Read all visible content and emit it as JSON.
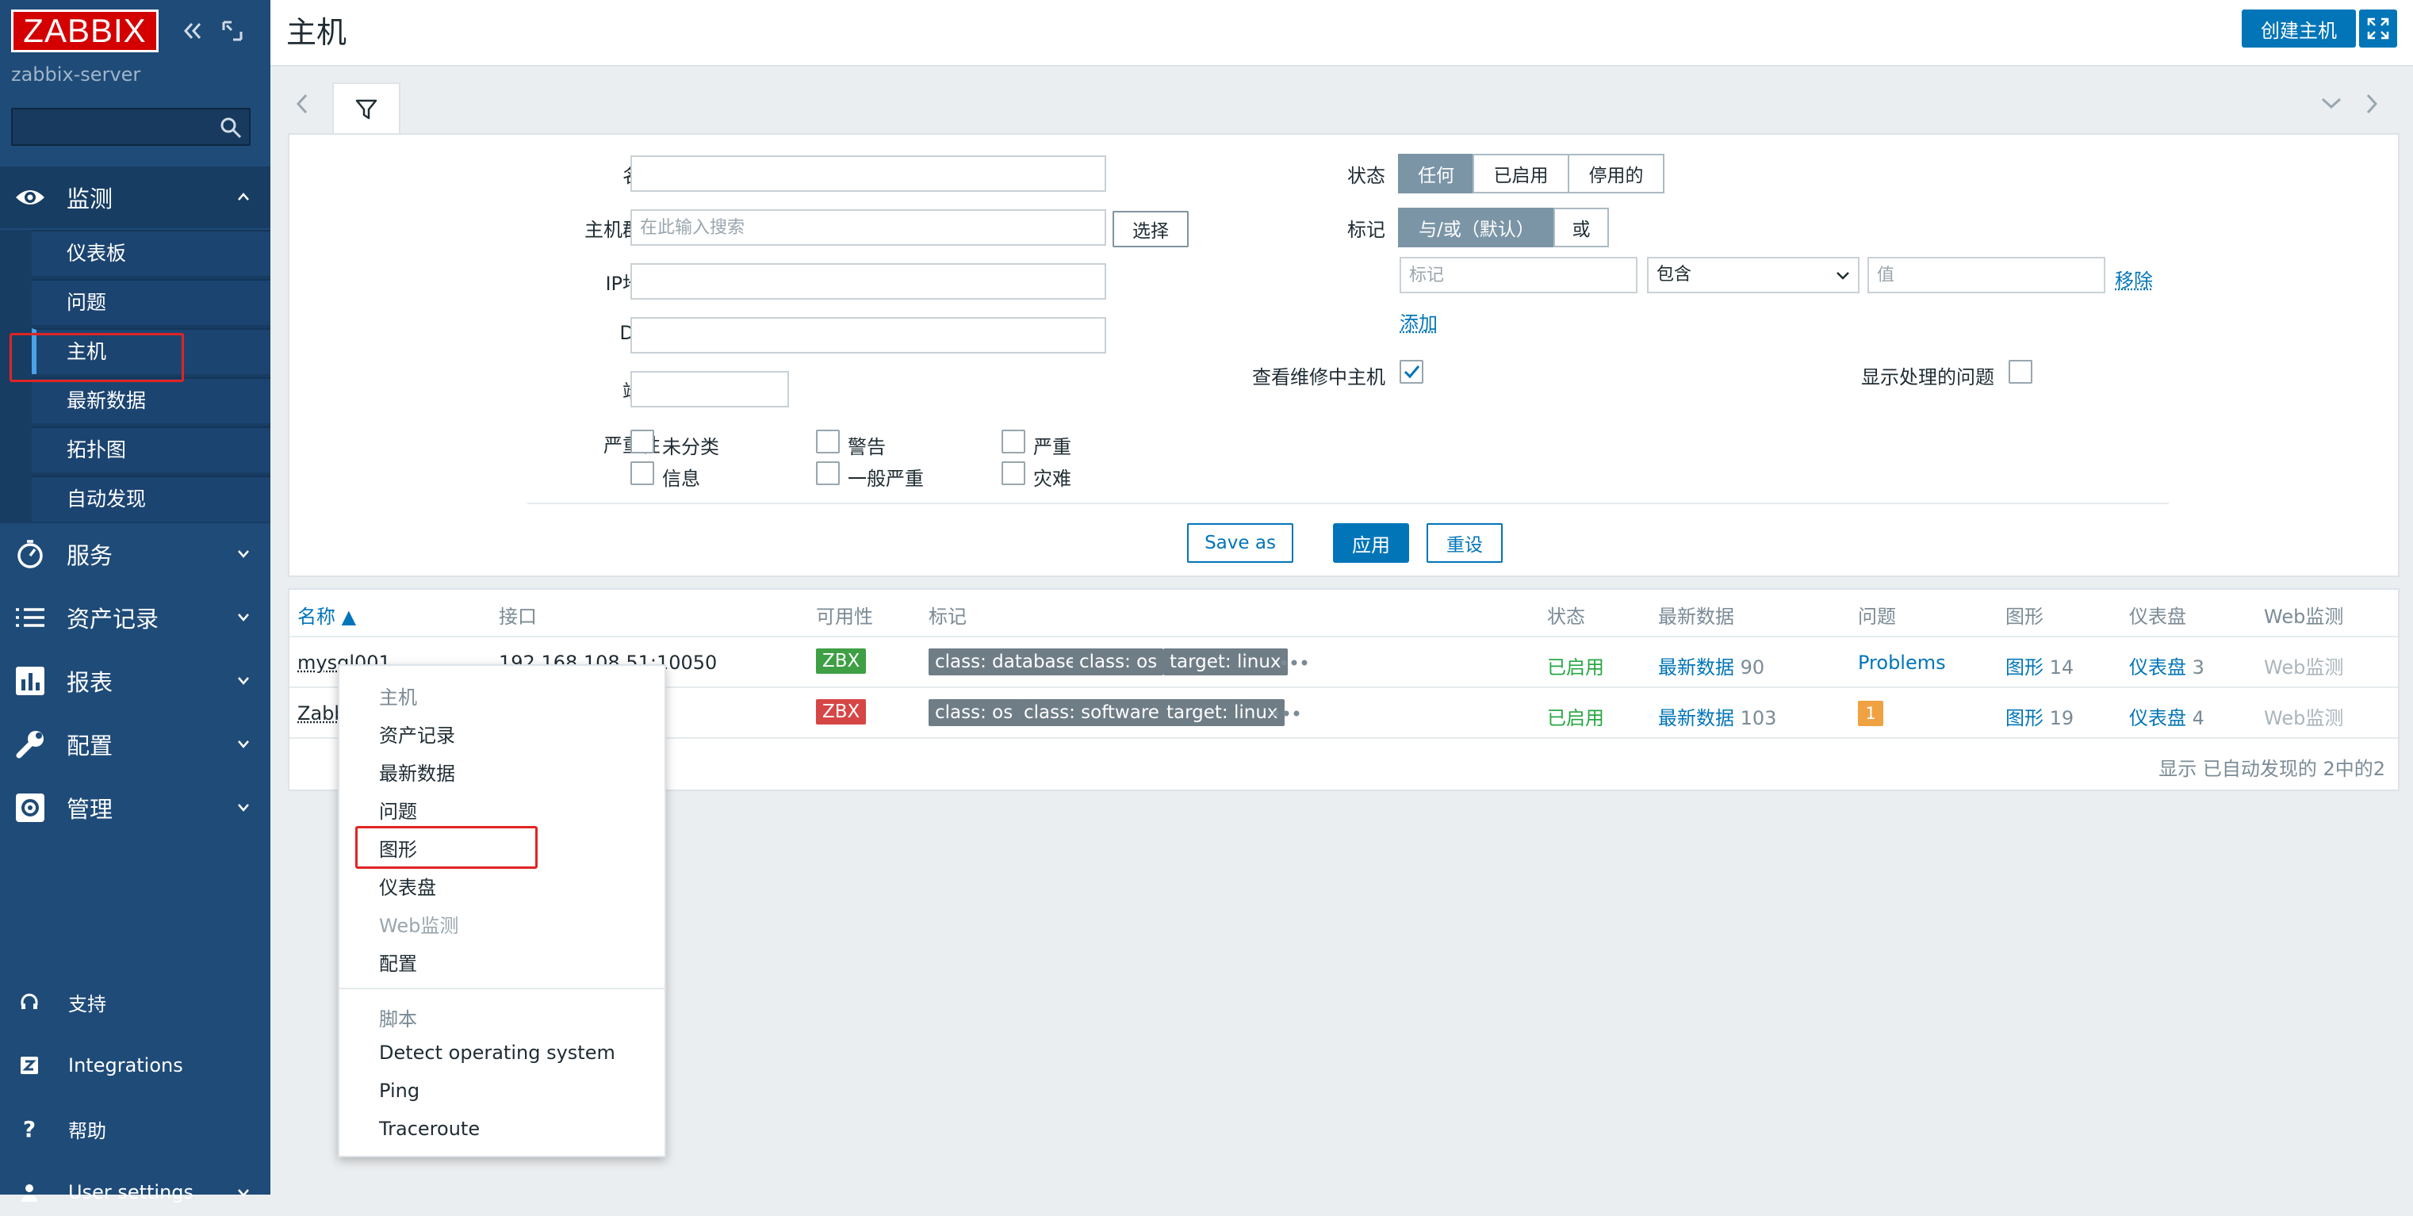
{
  "app": {
    "logo": "ZABBIX",
    "server_name": "zabbix-server",
    "page_title": "主机",
    "create_host": "创建主机"
  },
  "sidebar": {
    "search_placeholder": "",
    "sections": [
      {
        "label": "监测",
        "icon": "eye-icon"
      },
      {
        "label": "服务",
        "icon": "stopwatch-icon"
      },
      {
        "label": "资产记录",
        "icon": "list-icon"
      },
      {
        "label": "报表",
        "icon": "bar-chart-icon"
      },
      {
        "label": "配置",
        "icon": "wrench-icon"
      },
      {
        "label": "管理",
        "icon": "gear-icon"
      }
    ],
    "monitor_items": [
      "仪表板",
      "问题",
      "主机",
      "最新数据",
      "拓扑图",
      "自动发现"
    ],
    "active_item": "主机",
    "bottom": [
      {
        "label": "支持",
        "icon": "headset-icon"
      },
      {
        "label": "Integrations",
        "icon": "z-icon"
      },
      {
        "label": "帮助",
        "icon": "question-icon"
      },
      {
        "label": "User settings",
        "icon": "user-icon"
      }
    ]
  },
  "filter": {
    "labels": {
      "name": "名称",
      "host_group": "主机群组",
      "ip": "IP地址",
      "dns": "DNS",
      "port": "端口",
      "severity": "严重性",
      "status": "状态",
      "tags": "标记",
      "maintenance": "查看维修中主机",
      "show_suppressed": "显示处理的问题"
    },
    "values": {
      "name": "",
      "ip": "",
      "dns": "",
      "port": "",
      "tag": "",
      "tag_value": ""
    },
    "host_group_placeholder": "在此输入搜索",
    "select_button": "选择",
    "status_options": [
      "任何",
      "已启用",
      "停用的"
    ],
    "status_selected": "任何",
    "tag_eval_options": [
      "与/或（默认）",
      "或"
    ],
    "tag_eval_selected": "与/或（默认）",
    "tag_placeholder": "标记",
    "tag_operator": "包含",
    "value_placeholder": "值",
    "remove": "移除",
    "add": "添加",
    "maintenance_checked": true,
    "show_suppressed_checked": false,
    "severities": [
      "未分类",
      "警告",
      "严重",
      "信息",
      "一般严重",
      "灾难"
    ],
    "save_as": "Save as",
    "apply": "应用",
    "reset": "重设"
  },
  "table": {
    "headers": [
      "名称 ▲",
      "接口",
      "可用性",
      "标记",
      "状态",
      "最新数据",
      "问题",
      "图形",
      "仪表盘",
      "Web监测"
    ],
    "rows": [
      {
        "name": "mysql001",
        "interface": "192.168.108.51:10050",
        "availability": "ZBX",
        "tags": [
          "class: database",
          "class: os",
          "target: linux"
        ],
        "status": "已启用",
        "latest_label": "最新数据",
        "latest_count": "90",
        "problems": "Problems",
        "graphs_label": "图形",
        "graphs_count": "14",
        "dash_label": "仪表盘",
        "dash_count": "3",
        "web": "Web监测"
      },
      {
        "name": "Zabbix server",
        "interface": "",
        "availability": "ZBX",
        "tags": [
          "class: os",
          "class: software",
          "target: linux"
        ],
        "status": "已启用",
        "latest_label": "最新数据",
        "latest_count": "103",
        "problems": "1",
        "graphs_label": "图形",
        "graphs_count": "19",
        "dash_label": "仪表盘",
        "dash_count": "4",
        "web": "Web监测"
      }
    ],
    "footer": "显示 已自动发现的 2中的2"
  },
  "context_menu": {
    "host_header": "主机",
    "items": [
      "资产记录",
      "最新数据",
      "问题",
      "图形",
      "仪表盘",
      "Web监测",
      "配置"
    ],
    "highlighted": "图形",
    "disabled": "Web监测",
    "scripts_header": "脚本",
    "scripts": [
      "Detect operating system",
      "Ping",
      "Traceroute"
    ]
  },
  "colors": {
    "sidebar": "#1f4b78",
    "accent": "#0275b8",
    "logo_red": "#d40000",
    "highlight_red": "#e02424",
    "enabled_green": "#28a745"
  }
}
